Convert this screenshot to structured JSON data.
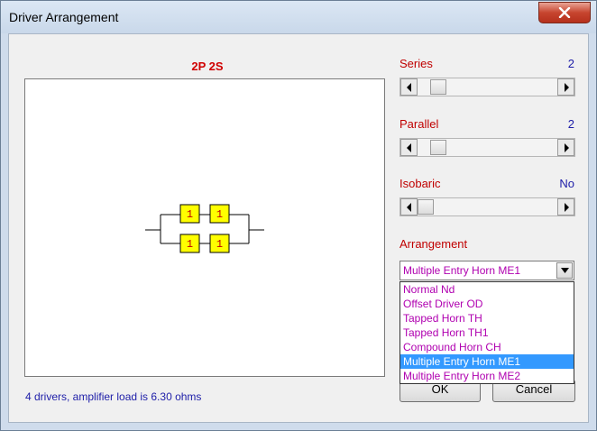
{
  "window": {
    "title": "Driver Arrangement"
  },
  "diagram": {
    "title": "2P 2S",
    "driver_label": "1",
    "status": "4 drivers, amplifier load is 6.30 ohms"
  },
  "controls": {
    "series": {
      "label": "Series",
      "value": "2",
      "position_fraction": 0.1
    },
    "parallel": {
      "label": "Parallel",
      "value": "2",
      "position_fraction": 0.1
    },
    "isobaric": {
      "label": "Isobaric",
      "value": "No",
      "position_fraction": 0.0
    },
    "arrangement": {
      "label": "Arrangement",
      "selected": "Multiple Entry Horn ME1",
      "options": [
        "Normal Nd",
        "Offset Driver OD",
        "Tapped Horn TH",
        "Tapped Horn TH1",
        "Compound Horn CH",
        "Multiple Entry Horn ME1",
        "Multiple Entry Horn ME2"
      ]
    }
  },
  "buttons": {
    "ok": "OK",
    "cancel": "Cancel"
  },
  "colors": {
    "title_red": "#d00000",
    "label_red": "#c00000",
    "value_blue": "#1d1da8",
    "option_magenta": "#b000b0",
    "selection_blue": "#3399ff",
    "driver_fill": "#ffff00"
  }
}
